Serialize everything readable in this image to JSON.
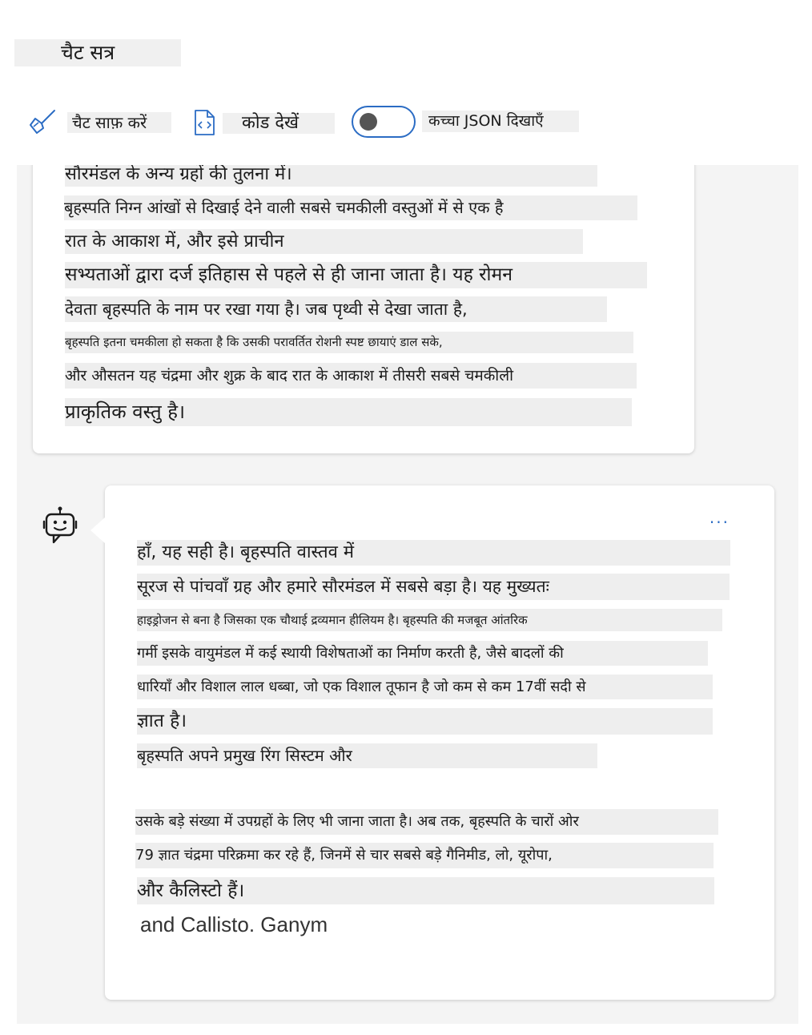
{
  "section": {
    "title": "चैट सत्र"
  },
  "toolbar": {
    "clear_label": "चैट साफ़ करें",
    "view_code_label": "कोड देखें",
    "raw_json_label": "कच्चा JSON दिखाएँ",
    "raw_json_on": false
  },
  "user_message": {
    "lines": [
      "सौरमंडल के अन्य ग्रहों की तुलना में।",
      "बृहस्पति निग्न आंखों से दिखाई देने वाली सबसे चमकीली वस्तुओं में से एक है",
      "रात के आकाश में, और इसे प्राचीन",
      "सभ्यताओं द्वारा दर्ज इतिहास से पहले से ही जाना जाता है। यह रोमन",
      "देवता बृहस्पति के नाम पर रखा गया है। जब पृथ्वी से देखा जाता है,",
      "बृहस्पति इतना चमकीला हो सकता है कि उसकी परावर्तित रोशनी स्पष्ट छायाएं डाल सके,",
      "और औसतन यह चंद्रमा और शुक्र के बाद रात के आकाश में तीसरी सबसे चमकीली",
      "प्राकृतिक वस्तु है।"
    ]
  },
  "bot_message": {
    "more_label": "...",
    "lines": [
      "हाँ, यह सही है। बृहस्पति वास्तव में",
      "सूरज से पांचवाँ ग्रह और हमारे सौरमंडल में सबसे बड़ा है। यह मुख्यतः",
      "हाइड्रोजन से बना है जिसका एक चौथाई द्रव्यमान हीलियम है। बृहस्पति की मजबूत आंतरिक",
      "गर्मी इसके वायुमंडल में कई स्थायी विशेषताओं का निर्माण करती है, जैसे बादलों की",
      "धारियाँ और विशाल लाल धब्बा, जो एक विशाल तूफान है जो कम से कम 17वीं सदी से",
      "ज्ञात है।",
      "बृहस्पति अपने प्रमुख रिंग सिस्टम और",
      "उसके बड़े संख्या में उपग्रहों के लिए भी जाना जाता है। अब तक, बृहस्पति के चारों ओर",
      "79 ज्ञात चंद्रमा परिक्रमा कर रहे हैं, जिनमें से चार सबसे बड़े गैनिमीड, लो, यूरोपा,",
      "और कैलिस्टो हैं।"
    ],
    "trailing_text": "and Callisto. Ganym"
  }
}
